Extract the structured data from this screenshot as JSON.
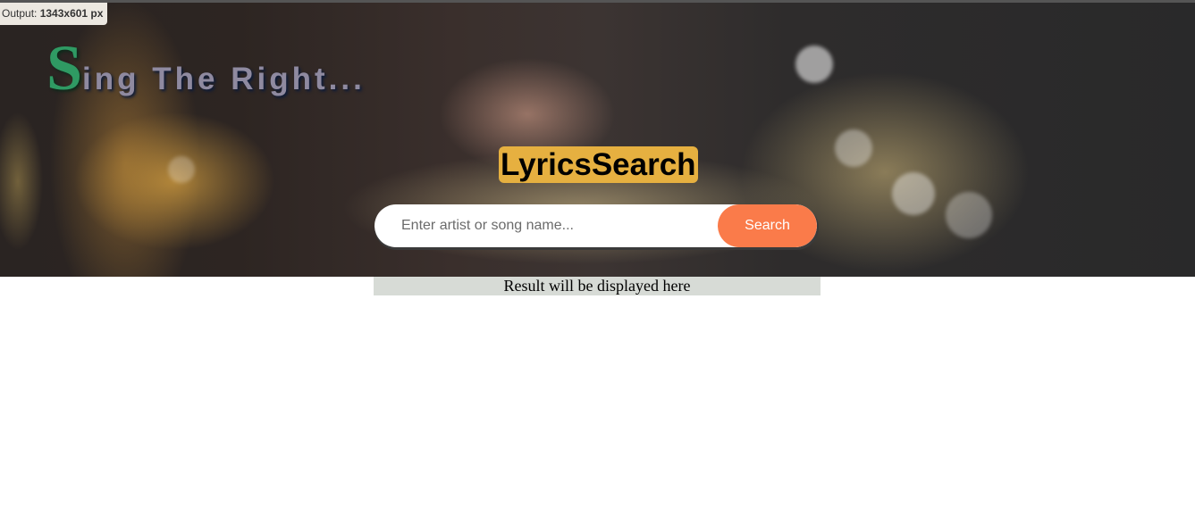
{
  "output_badge": {
    "label": "Output:",
    "value": "1343x601 px"
  },
  "header": {
    "logo_initial": "S",
    "logo_rest": "ing The Right...",
    "title": "LyricsSearch"
  },
  "search": {
    "placeholder": "Enter artist or song name...",
    "value": "",
    "button_label": "Search"
  },
  "result": {
    "text": "Result will be displayed here"
  },
  "colors": {
    "title_background": "#e6b040",
    "search_button": "#fa7b4a",
    "logo_initial": "#2f9a63",
    "result_background": "#d7dbd6"
  }
}
